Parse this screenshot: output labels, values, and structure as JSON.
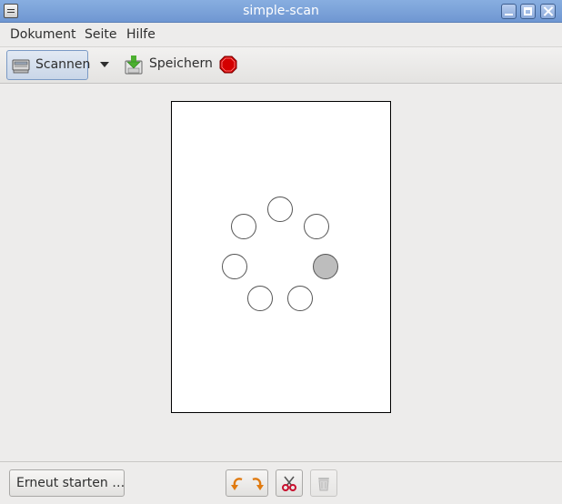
{
  "window": {
    "title": "simple-scan"
  },
  "menubar": {
    "items": [
      "Dokument",
      "Seite",
      "Hilfe"
    ]
  },
  "toolbar": {
    "scan_label": "Scannen",
    "save_label": "Speichern"
  },
  "spinner": {
    "dot_count": 7,
    "active_index": 2
  },
  "bottom": {
    "restart_label": "Erneut starten …"
  },
  "colors": {
    "titlebar": "#7aa1d8",
    "stop": "#d40000",
    "spinner_active": "#bdbdbd"
  }
}
